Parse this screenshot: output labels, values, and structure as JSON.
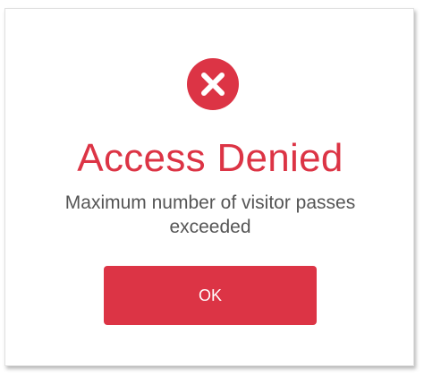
{
  "dialog": {
    "icon": "error-x-icon",
    "title": "Access Denied",
    "message": "Maximum number of visitor passes exceeded",
    "ok_label": "OK"
  },
  "colors": {
    "accent": "#dc3445",
    "message_text": "#555555",
    "background": "#ffffff"
  }
}
